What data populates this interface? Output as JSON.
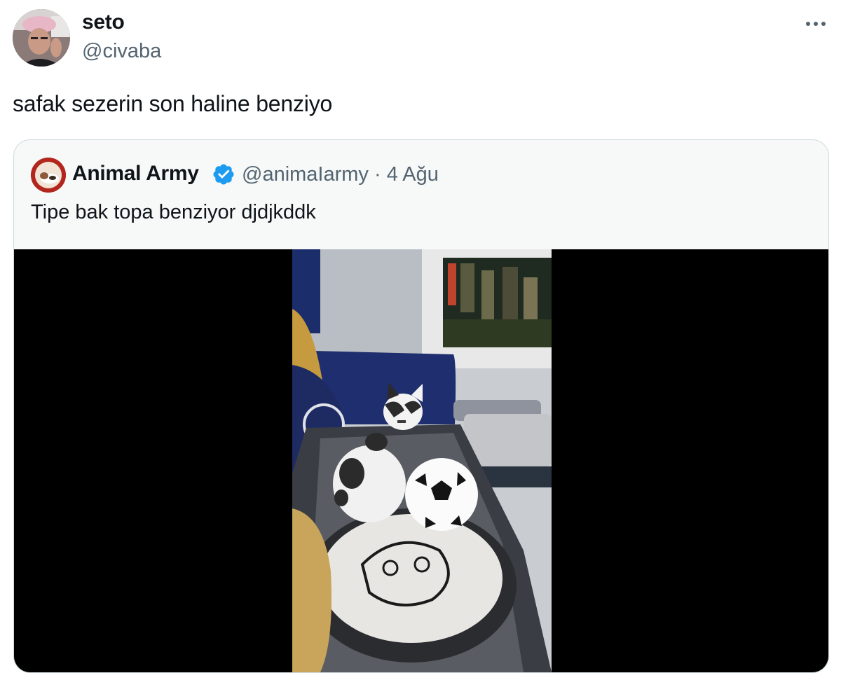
{
  "author": {
    "display_name": "seto",
    "handle": "@civaba",
    "avatar_icon": "profile-photo"
  },
  "more_icon": "more-horizontal-icon",
  "tweet": {
    "text": "safak sezerin son haline benziyo"
  },
  "quoted": {
    "display_name": "Animal Army",
    "handle_line": "@animaIarmy · 4 Ağu",
    "verified": true,
    "verified_color": "#1d9bf0",
    "text": "Tipe bak topa benziyor djdjkddk",
    "media": {
      "type": "video",
      "description_icon": "video-thumbnail"
    }
  },
  "colors": {
    "text_primary": "#0f1419",
    "text_secondary": "#536471",
    "border": "#cfd9de",
    "quote_bg": "#f7f9f9"
  }
}
